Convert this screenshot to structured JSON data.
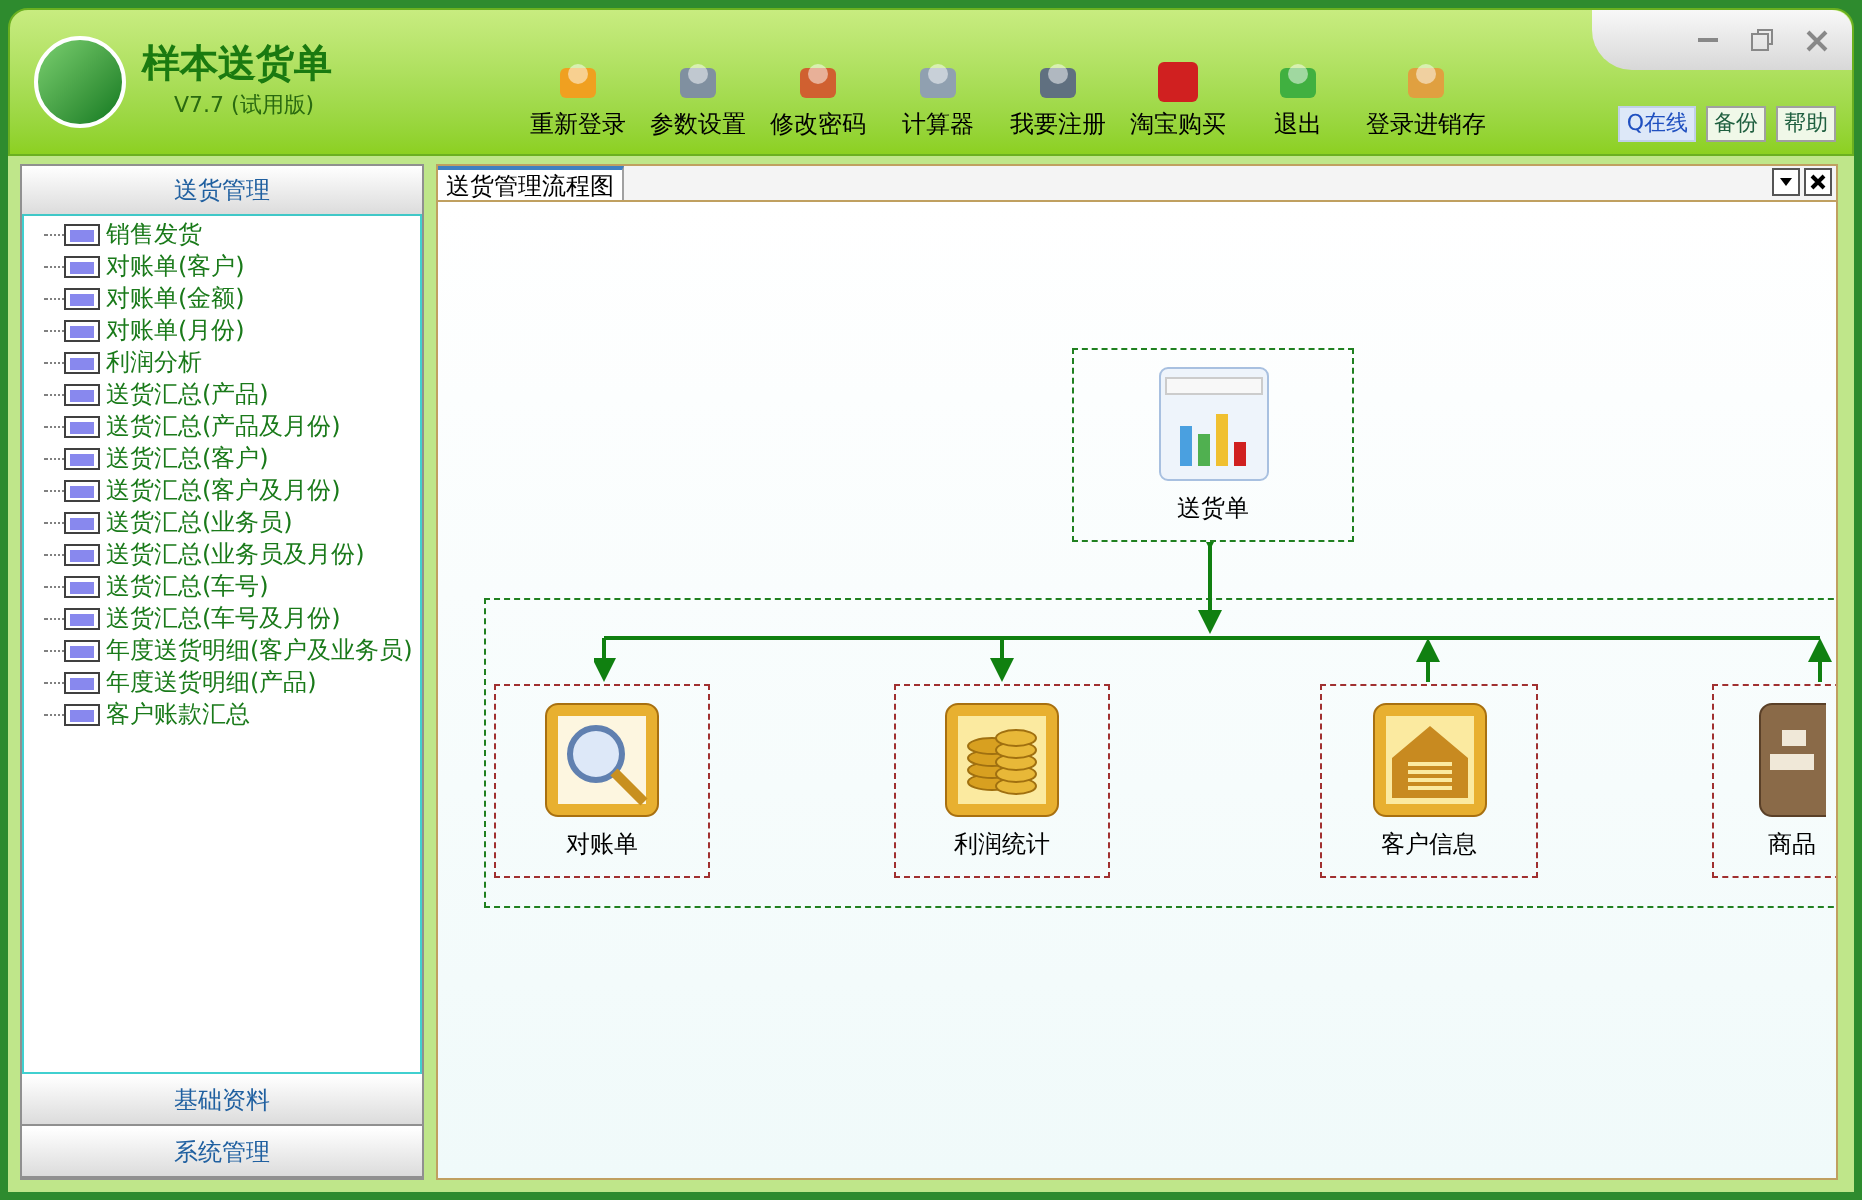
{
  "app": {
    "title": "样本送货单",
    "version": "V7.7 (试用版)"
  },
  "toolbar": [
    {
      "label": "重新登录"
    },
    {
      "label": "参数设置"
    },
    {
      "label": "修改密码"
    },
    {
      "label": "计算器"
    },
    {
      "label": "我要注册"
    },
    {
      "label": "淘宝购买"
    },
    {
      "label": "退出"
    },
    {
      "label": "登录进销存"
    }
  ],
  "top_links": [
    "Q在线",
    "备份",
    "帮助"
  ],
  "sidebar": {
    "sections": [
      {
        "title": "送货管理",
        "expanded": true,
        "items": [
          {
            "label": "销售发货"
          },
          {
            "label": "对账单(客户)"
          },
          {
            "label": "对账单(金额)"
          },
          {
            "label": "对账单(月份)"
          },
          {
            "label": "利润分析"
          },
          {
            "label": "送货汇总(产品)"
          },
          {
            "label": "送货汇总(产品及月份)"
          },
          {
            "label": "送货汇总(客户)"
          },
          {
            "label": "送货汇总(客户及月份)"
          },
          {
            "label": "送货汇总(业务员)"
          },
          {
            "label": "送货汇总(业务员及月份)"
          },
          {
            "label": "送货汇总(车号)"
          },
          {
            "label": "送货汇总(车号及月份)"
          },
          {
            "label": "年度送货明细(客户及业务员)"
          },
          {
            "label": "年度送货明细(产品)"
          },
          {
            "label": "客户账款汇总"
          }
        ]
      },
      {
        "title": "基础资料",
        "expanded": false
      },
      {
        "title": "系统管理",
        "expanded": false
      }
    ]
  },
  "tabs": [
    {
      "label": "送货管理流程图",
      "selected": true
    }
  ],
  "diagram": {
    "top_node": {
      "label": "送货单"
    },
    "nodes": [
      {
        "label": "对账单",
        "kind": "down"
      },
      {
        "label": "利润统计",
        "kind": "down"
      },
      {
        "label": "客户信息",
        "kind": "up"
      },
      {
        "label": "商品",
        "kind": "up"
      }
    ]
  }
}
